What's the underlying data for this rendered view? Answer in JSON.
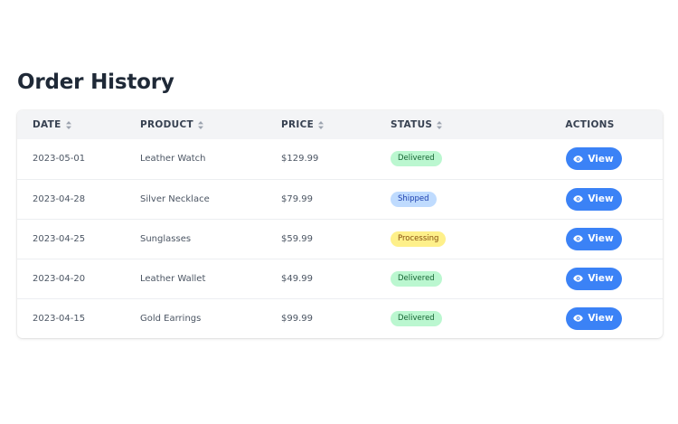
{
  "page": {
    "title": "Order History"
  },
  "table": {
    "headers": {
      "date": "DATE",
      "product": "PRODUCT",
      "price": "PRICE",
      "status": "STATUS",
      "actions": "ACTIONS"
    },
    "sortable_icon": "sort-icon",
    "rows": [
      {
        "date": "2023-05-01",
        "product": "Leather Watch",
        "price": "$129.99",
        "status": "Delivered",
        "action": "View"
      },
      {
        "date": "2023-04-28",
        "product": "Silver Necklace",
        "price": "$79.99",
        "status": "Shipped",
        "action": "View"
      },
      {
        "date": "2023-04-25",
        "product": "Sunglasses",
        "price": "$59.99",
        "status": "Processing",
        "action": "View"
      },
      {
        "date": "2023-04-20",
        "product": "Leather Wallet",
        "price": "$49.99",
        "status": "Delivered",
        "action": "View"
      },
      {
        "date": "2023-04-15",
        "product": "Gold Earrings",
        "price": "$99.99",
        "status": "Delivered",
        "action": "View"
      }
    ]
  },
  "colors": {
    "accent": "#3b82f6",
    "header_bg": "#f3f4f6",
    "status_delivered": "#bbf7d0",
    "status_shipped": "#bfdbfe",
    "status_processing": "#fef08a"
  }
}
